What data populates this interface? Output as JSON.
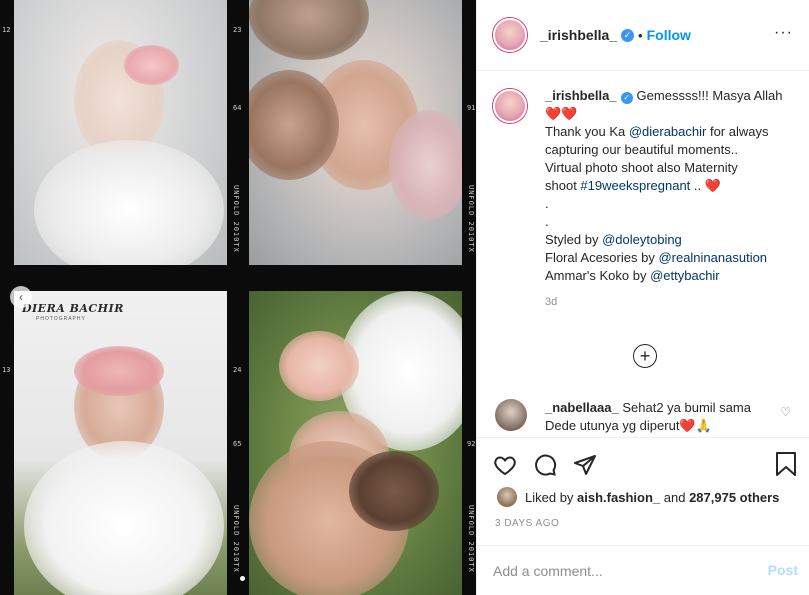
{
  "post": {
    "photo_watermark": "DIERA BACHIR",
    "photo_watermark_sub": "PHOTOGRAPHY",
    "film_labels": [
      "UNFOLD 2010TX",
      "UNFOLD 2010TX",
      "UNFOLD 2010TX",
      "UNFOLD 2010TX"
    ],
    "film_numbers": [
      "23",
      "64",
      "91",
      "24",
      "65",
      "92",
      "12",
      "13"
    ]
  },
  "header": {
    "username": "_irishbella_",
    "separator": "•",
    "follow_label": "Follow",
    "more_label": "···"
  },
  "caption": {
    "username": "_irishbella_",
    "lines": [
      "Gemessss!!! Masya Allah",
      "❤️❤️",
      "Thank you Ka @dierabachir for always",
      "capturing our beautiful moments..",
      "Virtual photo shoot also Maternity",
      "shoot #19weekspregnant .. ❤️",
      ".",
      ".",
      "Styled by @doleytobing",
      "Floral Acesories by @realninanasution",
      "Ammar's Koko by @ettybachir"
    ],
    "mentions": {
      "m1": "@dierabachir",
      "m2": "#19weekspregnant",
      "m3": "@doleytobing",
      "m4": "@realninanasution",
      "m5": "@ettybachir"
    },
    "time_ago": "3d"
  },
  "comments": [
    {
      "username": "_nabellaaa_",
      "text": "Sehat2 ya bumil sama Dede utunya yg diperut❤️🙏"
    }
  ],
  "likes": {
    "prefix": "Liked by",
    "user": "aish.fashion_",
    "and": "and",
    "others": "287,975 others"
  },
  "date": "3 DAYS AGO",
  "comment_box": {
    "placeholder": "Add a comment...",
    "post_label": "Post"
  },
  "colors": {
    "accent": "#0095f6",
    "verified": "#3897f0",
    "muted": "#8e8e8e",
    "border": "#efefef"
  },
  "icons": [
    "heart-icon",
    "comment-icon",
    "share-icon",
    "bookmark-icon",
    "plus-circle-icon",
    "chevron-left-icon",
    "more-icon"
  ]
}
